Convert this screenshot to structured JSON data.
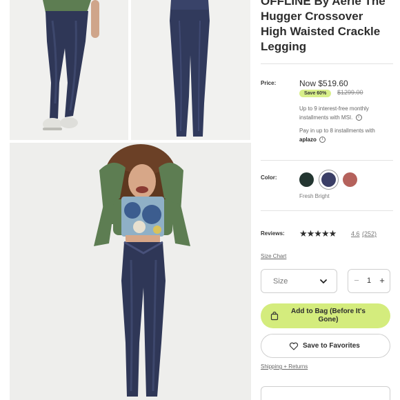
{
  "product": {
    "title_lines": [
      "OFFLINE By Aerie The",
      "Hugger Crossover",
      "High Waisted Crackle",
      "Legging"
    ]
  },
  "price": {
    "label": "Price:",
    "now": "Now $519.60",
    "save_badge": "Save 60%",
    "original": "$1299.00"
  },
  "installments": {
    "msi_text": "Up to 9 interest-free monthly installments with MSI.",
    "aplazo_text": "Pay in up to 8 installments with",
    "aplazo_brand": "aplazo"
  },
  "color": {
    "label": "Color:",
    "selected_name": "Fresh Bright",
    "swatches": [
      {
        "hex": "#243631",
        "selected": false
      },
      {
        "hex": "#3b3f66",
        "selected": true
      },
      {
        "hex": "#b5625c",
        "selected": false
      }
    ]
  },
  "reviews": {
    "label": "Reviews:",
    "stars": "★★★★★",
    "rating": "4.6",
    "count": "(252)"
  },
  "size_chart_link": "Size Chart",
  "size_select": {
    "placeholder": "Size"
  },
  "quantity": {
    "minus": "−",
    "value": "1",
    "plus": "+"
  },
  "add_to_bag_label": "Add to Bag (Before It's Gone)",
  "favorites_label": "Save to Favorites",
  "shipping_link": "Shipping + Returns",
  "colors": {
    "accent_green": "#d4ec7d",
    "save_badge": "#d8ef8a",
    "legging_navy": "#2f3757",
    "sweater_green": "#5d7d52"
  }
}
